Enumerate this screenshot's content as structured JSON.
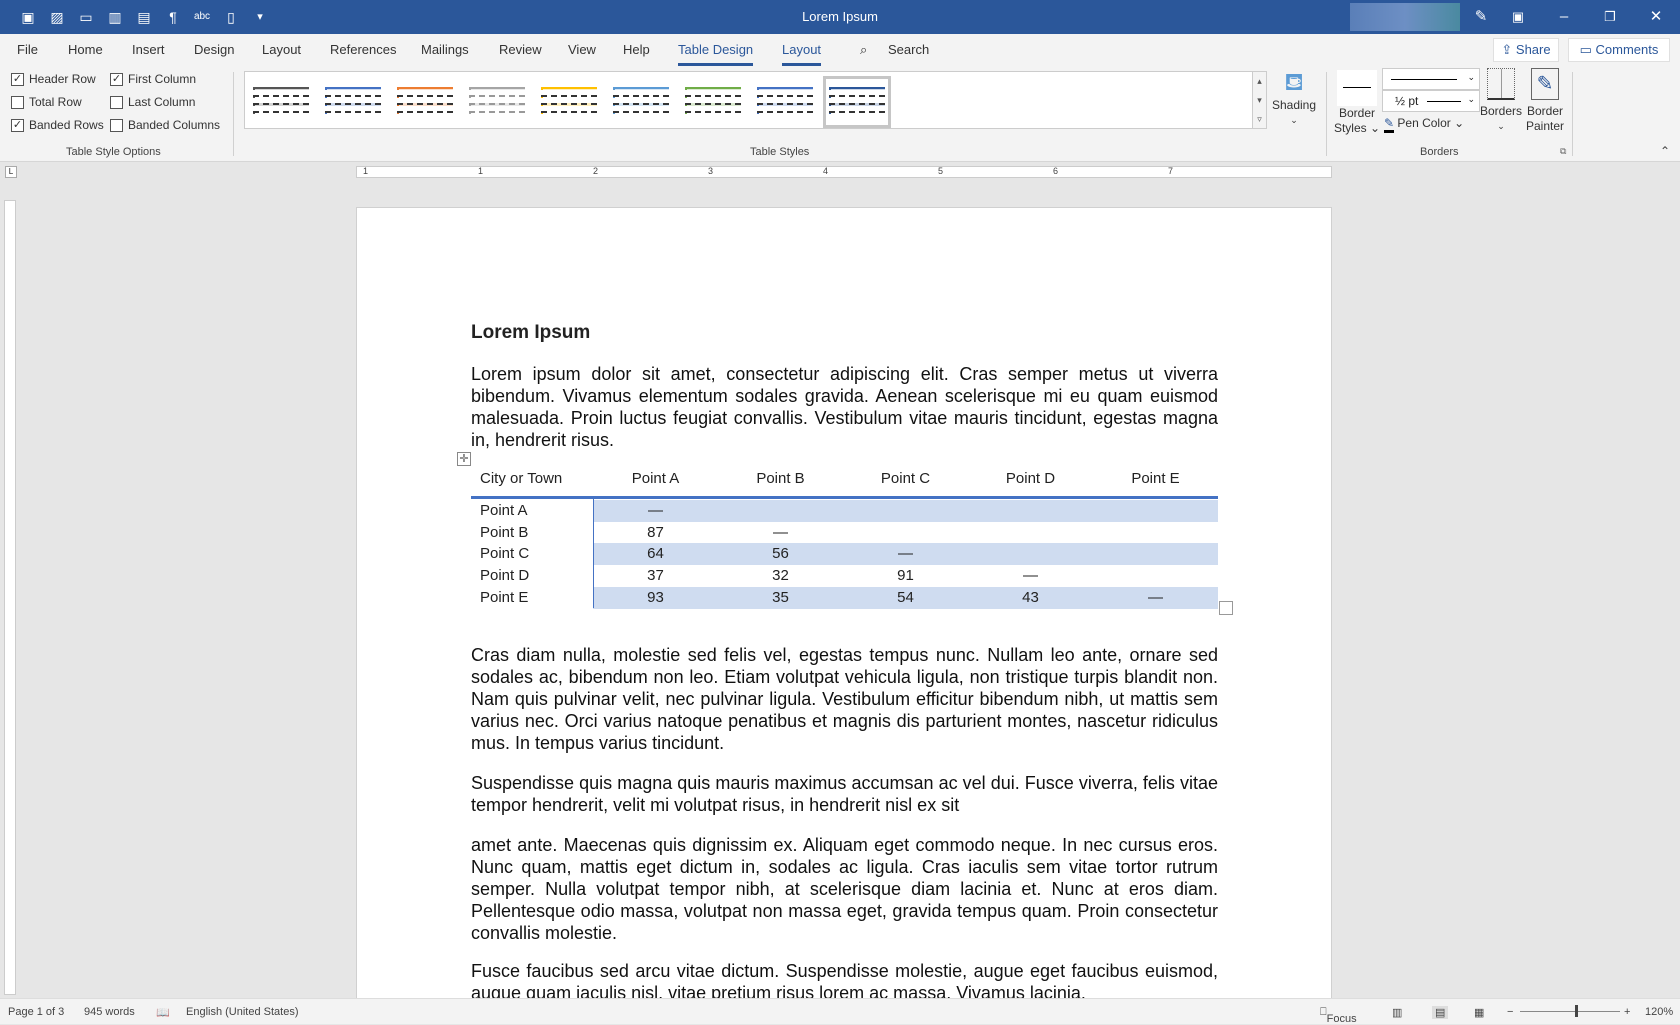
{
  "window": {
    "title": "Lorem Ipsum",
    "accent": "#2b579a"
  },
  "quick_access": [
    "save-icon",
    "save-as-icon",
    "open-icon",
    "read-mode-icon",
    "print-layout-icon",
    "paragraph-mark-icon",
    "spelling-icon",
    "new-document-icon",
    "customize-icon"
  ],
  "tabs": [
    "File",
    "Home",
    "Insert",
    "Design",
    "Layout",
    "References",
    "Mailings",
    "Review",
    "View",
    "Help",
    "Table Design",
    "Layout"
  ],
  "active_tab": "Table Design",
  "search": {
    "label": "Search"
  },
  "share_label": "Share",
  "comments_label": "Comments",
  "table_style_options": {
    "label": "Table Style Options",
    "items": [
      {
        "label": "Header Row",
        "checked": true
      },
      {
        "label": "First Column",
        "checked": true
      },
      {
        "label": "Total Row",
        "checked": false
      },
      {
        "label": "Last Column",
        "checked": false
      },
      {
        "label": "Banded Rows",
        "checked": true
      },
      {
        "label": "Banded Columns",
        "checked": false
      }
    ]
  },
  "table_styles": {
    "label": "Table Styles",
    "colors": [
      "#555555",
      "#4472c4",
      "#ed7d31",
      "#a5a5a5",
      "#ffc000",
      "#5b9bd5",
      "#70ad47",
      "#4472c4",
      "#2b579a"
    ]
  },
  "shading_label": "Shading",
  "borders": {
    "label": "Borders",
    "border_styles": "Border Styles",
    "pen_weight": "½ pt",
    "pen_color": "Pen Color",
    "borders_btn": "Borders",
    "border_painter": "Border Painter"
  },
  "ruler_numbers": [
    "1",
    "1",
    "2",
    "3",
    "4",
    "5",
    "6",
    "7"
  ],
  "document": {
    "heading": "Lorem Ipsum",
    "p1": "Lorem ipsum dolor sit amet, consectetur adipiscing elit. Cras semper metus ut viverra bibendum. Vivamus elementum sodales gravida. Aenean scelerisque mi eu quam euismod malesuada. Proin luctus feugiat convallis. Vestibulum vitae mauris tincidunt, egestas magna in, hendrerit risus.",
    "table": {
      "headers": [
        "City or Town",
        "Point A",
        "Point B",
        "Point C",
        "Point D",
        "Point E"
      ],
      "rows": [
        [
          "Point A",
          "—",
          "",
          "",
          "",
          ""
        ],
        [
          "Point B",
          "87",
          "—",
          "",
          "",
          ""
        ],
        [
          "Point C",
          "64",
          "56",
          "—",
          "",
          ""
        ],
        [
          "Point D",
          "37",
          "32",
          "91",
          "—",
          ""
        ],
        [
          "Point E",
          "93",
          "35",
          "54",
          "43",
          "—"
        ]
      ],
      "band_color": "#cfdcf0"
    },
    "p2": "Cras diam nulla, molestie sed felis vel, egestas tempus nunc. Nullam leo ante, ornare sed sodales ac, bibendum non leo. Etiam volutpat vehicula ligula, non tristique turpis blandit non. Nam quis pulvinar velit, nec pulvinar ligula. Vestibulum efficitur bibendum nibh, ut mattis sem varius nec. Orci varius natoque penatibus et magnis dis parturient montes, nascetur ridiculus mus. In tempus varius tincidunt.",
    "p3": "Suspendisse quis magna quis mauris maximus accumsan ac vel dui. Fusce viverra, felis vitae tempor hendrerit, velit mi volutpat risus, in hendrerit nisl ex sit",
    "p4": "amet ante. Maecenas quis dignissim ex. Aliquam eget commodo neque. In nec cursus eros. Nunc quam, mattis eget dictum in, sodales ac ligula. Cras iaculis sem vitae tortor rutrum semper. Nulla volutpat tempor nibh, at scelerisque diam lacinia et. Nunc at eros diam. Pellentesque odio massa, volutpat non massa eget, gravida tempus quam. Proin consectetur convallis molestie.",
    "p5": "Fusce faucibus sed arcu vitae dictum. Suspendisse molestie, augue eget faucibus euismod, augue quam iaculis nisl, vitae pretium risus lorem ac massa. Vivamus lacinia."
  },
  "status": {
    "page": "Page 1 of 3",
    "words": "945 words",
    "language": "English (United States)",
    "focus": "Focus",
    "zoom": "120%",
    "zoom_level": 120
  }
}
